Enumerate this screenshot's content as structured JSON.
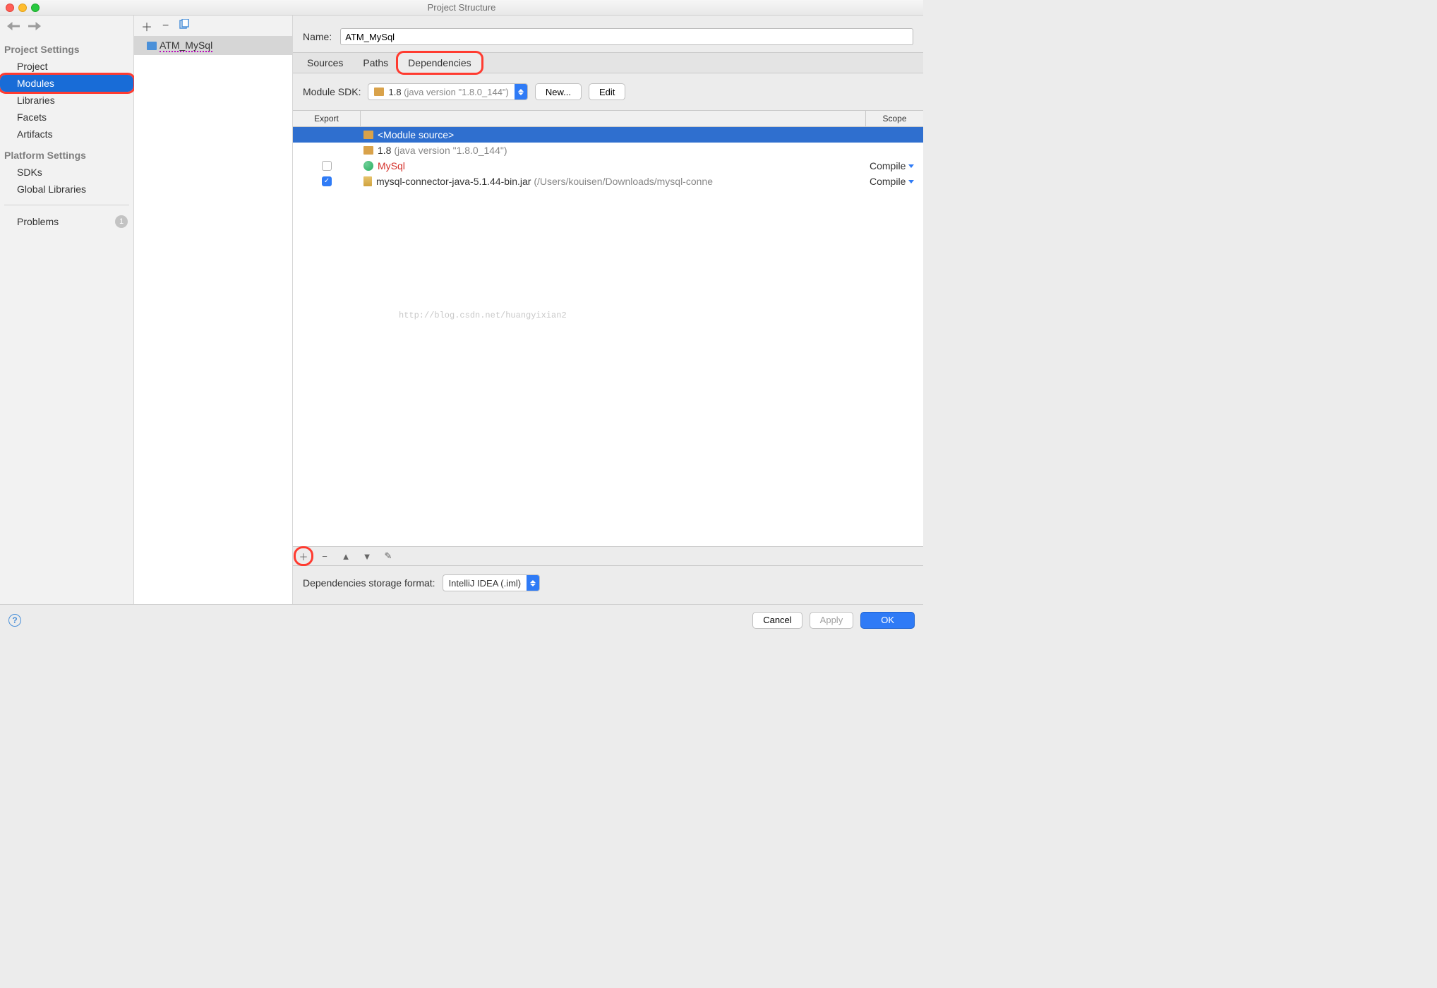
{
  "title": "Project Structure",
  "sidebar": {
    "projectSettingsHeader": "Project Settings",
    "platformSettingsHeader": "Platform Settings",
    "items": {
      "project": "Project",
      "modules": "Modules",
      "libraries": "Libraries",
      "facets": "Facets",
      "artifacts": "Artifacts",
      "sdks": "SDKs",
      "globalLibraries": "Global Libraries",
      "problems": "Problems"
    },
    "problemsCount": "1"
  },
  "moduleList": {
    "module0": "ATM_MySql"
  },
  "name": {
    "label": "Name:",
    "value": "ATM_MySql"
  },
  "tabs": {
    "sources": "Sources",
    "paths": "Paths",
    "dependencies": "Dependencies"
  },
  "sdk": {
    "label": "Module SDK:",
    "valuePrefix": "1.8 ",
    "valueSuffix": "(java version \"1.8.0_144\")",
    "newBtn": "New...",
    "editBtn": "Edit"
  },
  "depsHeader": {
    "export": "Export",
    "scope": "Scope"
  },
  "deps": {
    "r0": {
      "name": "<Module source>"
    },
    "r1": {
      "prefix": "1.8 ",
      "suffix": "(java version \"1.8.0_144\")"
    },
    "r2": {
      "name": "MySql",
      "scope": "Compile"
    },
    "r3": {
      "name": "mysql-connector-java-5.1.44-bin.jar ",
      "path": "(/Users/kouisen/Downloads/mysql-conne",
      "scope": "Compile"
    }
  },
  "watermark": "http://blog.csdn.net/huangyixian2",
  "storage": {
    "label": "Dependencies storage format:",
    "value": "IntelliJ IDEA (.iml)"
  },
  "buttons": {
    "cancel": "Cancel",
    "apply": "Apply",
    "ok": "OK"
  }
}
